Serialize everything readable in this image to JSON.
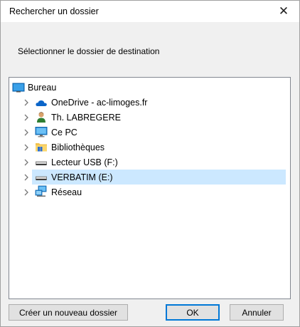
{
  "window": {
    "title": "Rechercher un dossier",
    "close_glyph": "✕"
  },
  "prompt": "Sélectionner le dossier de destination",
  "tree": {
    "root": {
      "label": "Bureau",
      "icon": "desktop-icon"
    },
    "items": [
      {
        "label": "OneDrive - ac-limoges.fr",
        "icon": "onedrive-cloud-icon",
        "selected": false
      },
      {
        "label": "Th. LABREGERE",
        "icon": "user-icon",
        "selected": false
      },
      {
        "label": "Ce PC",
        "icon": "computer-icon",
        "selected": false
      },
      {
        "label": "Bibliothèques",
        "icon": "libraries-folder-icon",
        "selected": false
      },
      {
        "label": "Lecteur USB (F:)",
        "icon": "drive-icon",
        "selected": false
      },
      {
        "label": "VERBATIM (E:)",
        "icon": "drive-icon",
        "selected": true
      },
      {
        "label": "Réseau",
        "icon": "network-icon",
        "selected": false
      }
    ]
  },
  "buttons": {
    "new_folder": "Créer un nouveau dossier",
    "ok": "OK",
    "cancel": "Annuler"
  },
  "colors": {
    "selection": "#cce8ff",
    "accent": "#0078d7"
  }
}
